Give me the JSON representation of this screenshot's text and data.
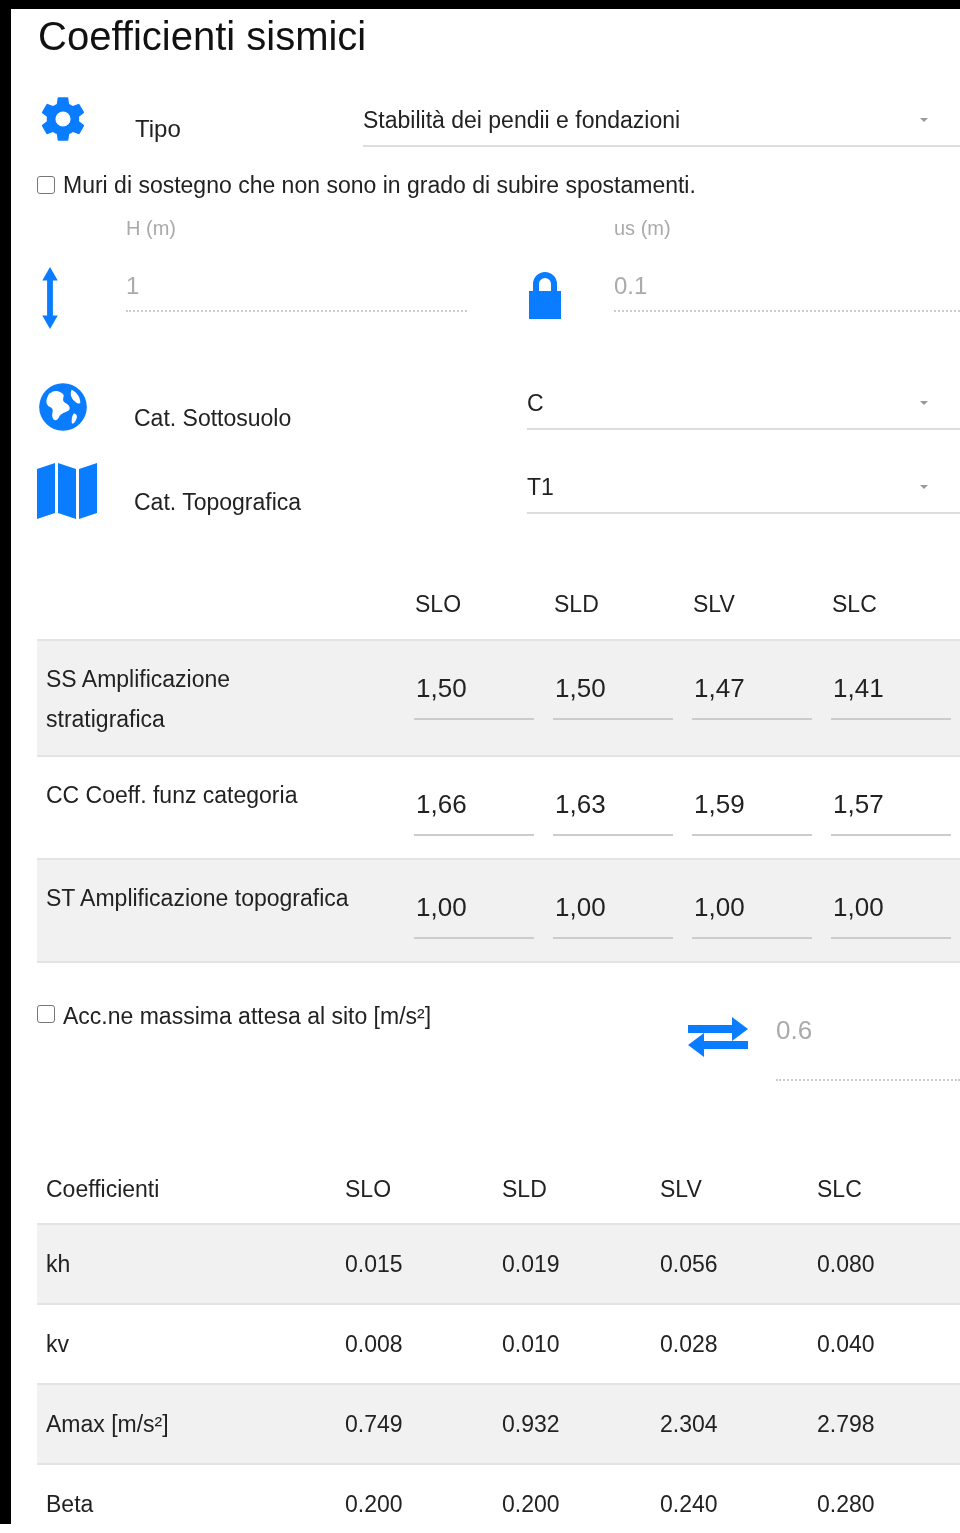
{
  "title": "Coefficienti sismici",
  "tipo": {
    "label": "Tipo",
    "value": "Stabilità dei pendii e fondazioni"
  },
  "muri_checkbox": {
    "label": "Muri di sostegno che non sono in grado di subire spostamenti.",
    "checked": false
  },
  "fields": [
    {
      "label": "H (m)",
      "value": "1",
      "disabled": true
    },
    {
      "label": "us (m)",
      "value": "0.1",
      "disabled": true
    }
  ],
  "categories": [
    {
      "label": "Cat. Sottosuolo",
      "value": "C"
    },
    {
      "label": "Cat. Topografica",
      "value": "T1"
    }
  ],
  "amplification_table": {
    "columns": [
      "SLO",
      "SLD",
      "SLV",
      "SLC"
    ],
    "rows": [
      {
        "label": "SS Amplificazione stratigrafica",
        "values": [
          "1,50",
          "1,50",
          "1,47",
          "1,41"
        ]
      },
      {
        "label": "CC Coeff. funz categoria",
        "values": [
          "1,66",
          "1,63",
          "1,59",
          "1,57"
        ]
      },
      {
        "label": "ST Amplificazione topografica",
        "values": [
          "1,00",
          "1,00",
          "1,00",
          "1,00"
        ]
      }
    ]
  },
  "acc_checkbox": {
    "label": "Acc.ne massima attesa al sito [m/s²]",
    "checked": false
  },
  "acc_field": {
    "value": "0.6",
    "disabled": true
  },
  "coefficients_table": {
    "columns": [
      "Coefficienti",
      "SLO",
      "SLD",
      "SLV",
      "SLC"
    ],
    "rows": [
      [
        "kh",
        "0.015",
        "0.019",
        "0.056",
        "0.080"
      ],
      [
        "kv",
        "0.008",
        "0.010",
        "0.028",
        "0.040"
      ],
      [
        "Amax [m/s²]",
        "0.749",
        "0.932",
        "2.304",
        "2.798"
      ],
      [
        "Beta",
        "0.200",
        "0.200",
        "0.240",
        "0.280"
      ]
    ]
  }
}
